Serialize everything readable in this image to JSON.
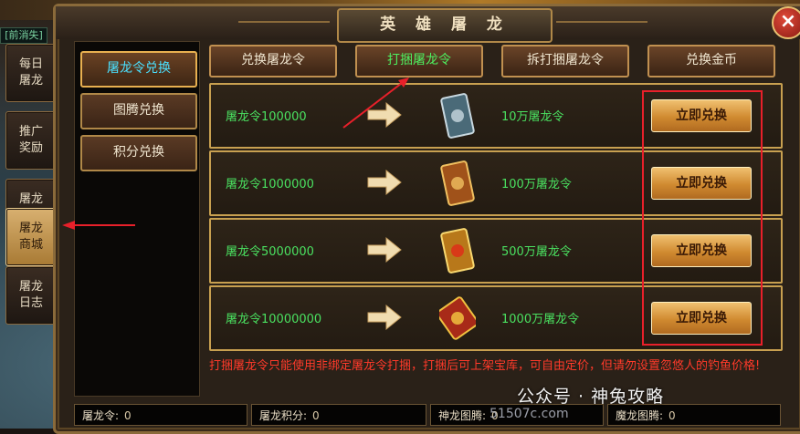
{
  "window": {
    "title": "英 雄 屠 龙"
  },
  "left_tag": "[前消失]",
  "side_tabs": [
    {
      "label": "每日\n屠龙",
      "active": false
    },
    {
      "label": "推广\n奖励",
      "active": false
    },
    {
      "label": "屠龙\n拼团",
      "active": false
    },
    {
      "label": "屠龙\n商城",
      "active": true
    },
    {
      "label": "屠龙\n日志",
      "active": false
    }
  ],
  "submenu": [
    {
      "label": "屠龙令兑换",
      "active": true
    },
    {
      "label": "图腾兑换",
      "active": false
    },
    {
      "label": "积分兑换",
      "active": false
    }
  ],
  "top_tabs": [
    {
      "label": "兑换屠龙令",
      "active": false
    },
    {
      "label": "打捆屠龙令",
      "active": true
    },
    {
      "label": "拆打捆屠龙令",
      "active": false
    },
    {
      "label": "兑换金币",
      "active": false
    }
  ],
  "rows": [
    {
      "cost": "屠龙令100000",
      "reward": "10万屠龙令",
      "button": "立即兑换",
      "card_color": "#4a6a78"
    },
    {
      "cost": "屠龙令1000000",
      "reward": "100万屠龙令",
      "button": "立即兑换",
      "card_color": "#a0521a"
    },
    {
      "cost": "屠龙令5000000",
      "reward": "500万屠龙令",
      "button": "立即兑换",
      "card_color": "#b8781a"
    },
    {
      "cost": "屠龙令10000000",
      "reward": "1000万屠龙令",
      "button": "立即兑换",
      "card_color": "#a82a18"
    }
  ],
  "notice": "打捆屠龙令只能使用非绑定屠龙令打捆，打捆后可上架宝库，可自由定价，但请勿设置忽悠人的钓鱼价格!",
  "stats": [
    {
      "label": "屠龙令:",
      "value": "0"
    },
    {
      "label": "屠龙积分:",
      "value": "0"
    },
    {
      "label": "神龙图腾:",
      "value": "0"
    },
    {
      "label": "魔龙图腾:",
      "value": "0"
    }
  ],
  "watermark": {
    "text": "公众号 · 神兔攻略",
    "sub": "51507c.com"
  },
  "colors": {
    "accent_green": "#4ae060",
    "accent_red": "#e8202a",
    "gold_border": "#c8a050"
  }
}
